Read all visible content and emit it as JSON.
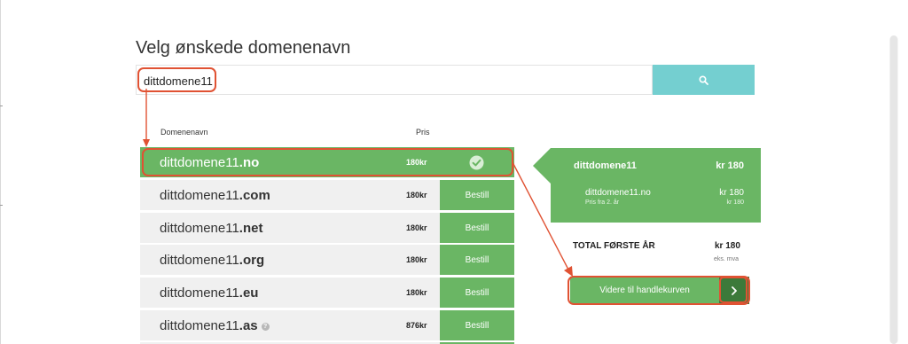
{
  "page": {
    "title": "Velg ønskede domenenavn"
  },
  "search": {
    "value": "dittdomene11",
    "placeholder": ""
  },
  "table": {
    "col_domain": "Domenenavn",
    "col_price": "Pris",
    "rows": [
      {
        "name": "dittdomene11",
        "tld": ".no",
        "price": "180kr",
        "selected": true,
        "action": ""
      },
      {
        "name": "dittdomene11",
        "tld": ".com",
        "price": "180kr",
        "selected": false,
        "action": "Bestill"
      },
      {
        "name": "dittdomene11",
        "tld": ".net",
        "price": "180kr",
        "selected": false,
        "action": "Bestill"
      },
      {
        "name": "dittdomene11",
        "tld": ".org",
        "price": "180kr",
        "selected": false,
        "action": "Bestill"
      },
      {
        "name": "dittdomene11",
        "tld": ".eu",
        "price": "180kr",
        "selected": false,
        "action": "Bestill"
      },
      {
        "name": "dittdomene11",
        "tld": ".as",
        "price": "876kr",
        "selected": false,
        "action": "Bestill",
        "info_icon": "question-icon"
      }
    ]
  },
  "cart": {
    "domain": "dittdomene11",
    "domain_price": "kr 180",
    "item": "dittdomene11.no",
    "item_price": "kr 180",
    "note": "Pris fra 2. år",
    "note_price": "kr 180",
    "total_label": "TOTAL FØRSTE ÅR",
    "total_price": "kr 180",
    "vat_note": "eks. mva",
    "cta_label": "Videre til handlekurven"
  },
  "icons": {
    "search": "search-icon",
    "selected": "check-circle-icon",
    "cta": "chevron-right-icon"
  },
  "colors": {
    "green": "#6ab664",
    "teal": "#74cfd0",
    "annotation": "#e05233",
    "dark_green": "#3c7a3a"
  }
}
